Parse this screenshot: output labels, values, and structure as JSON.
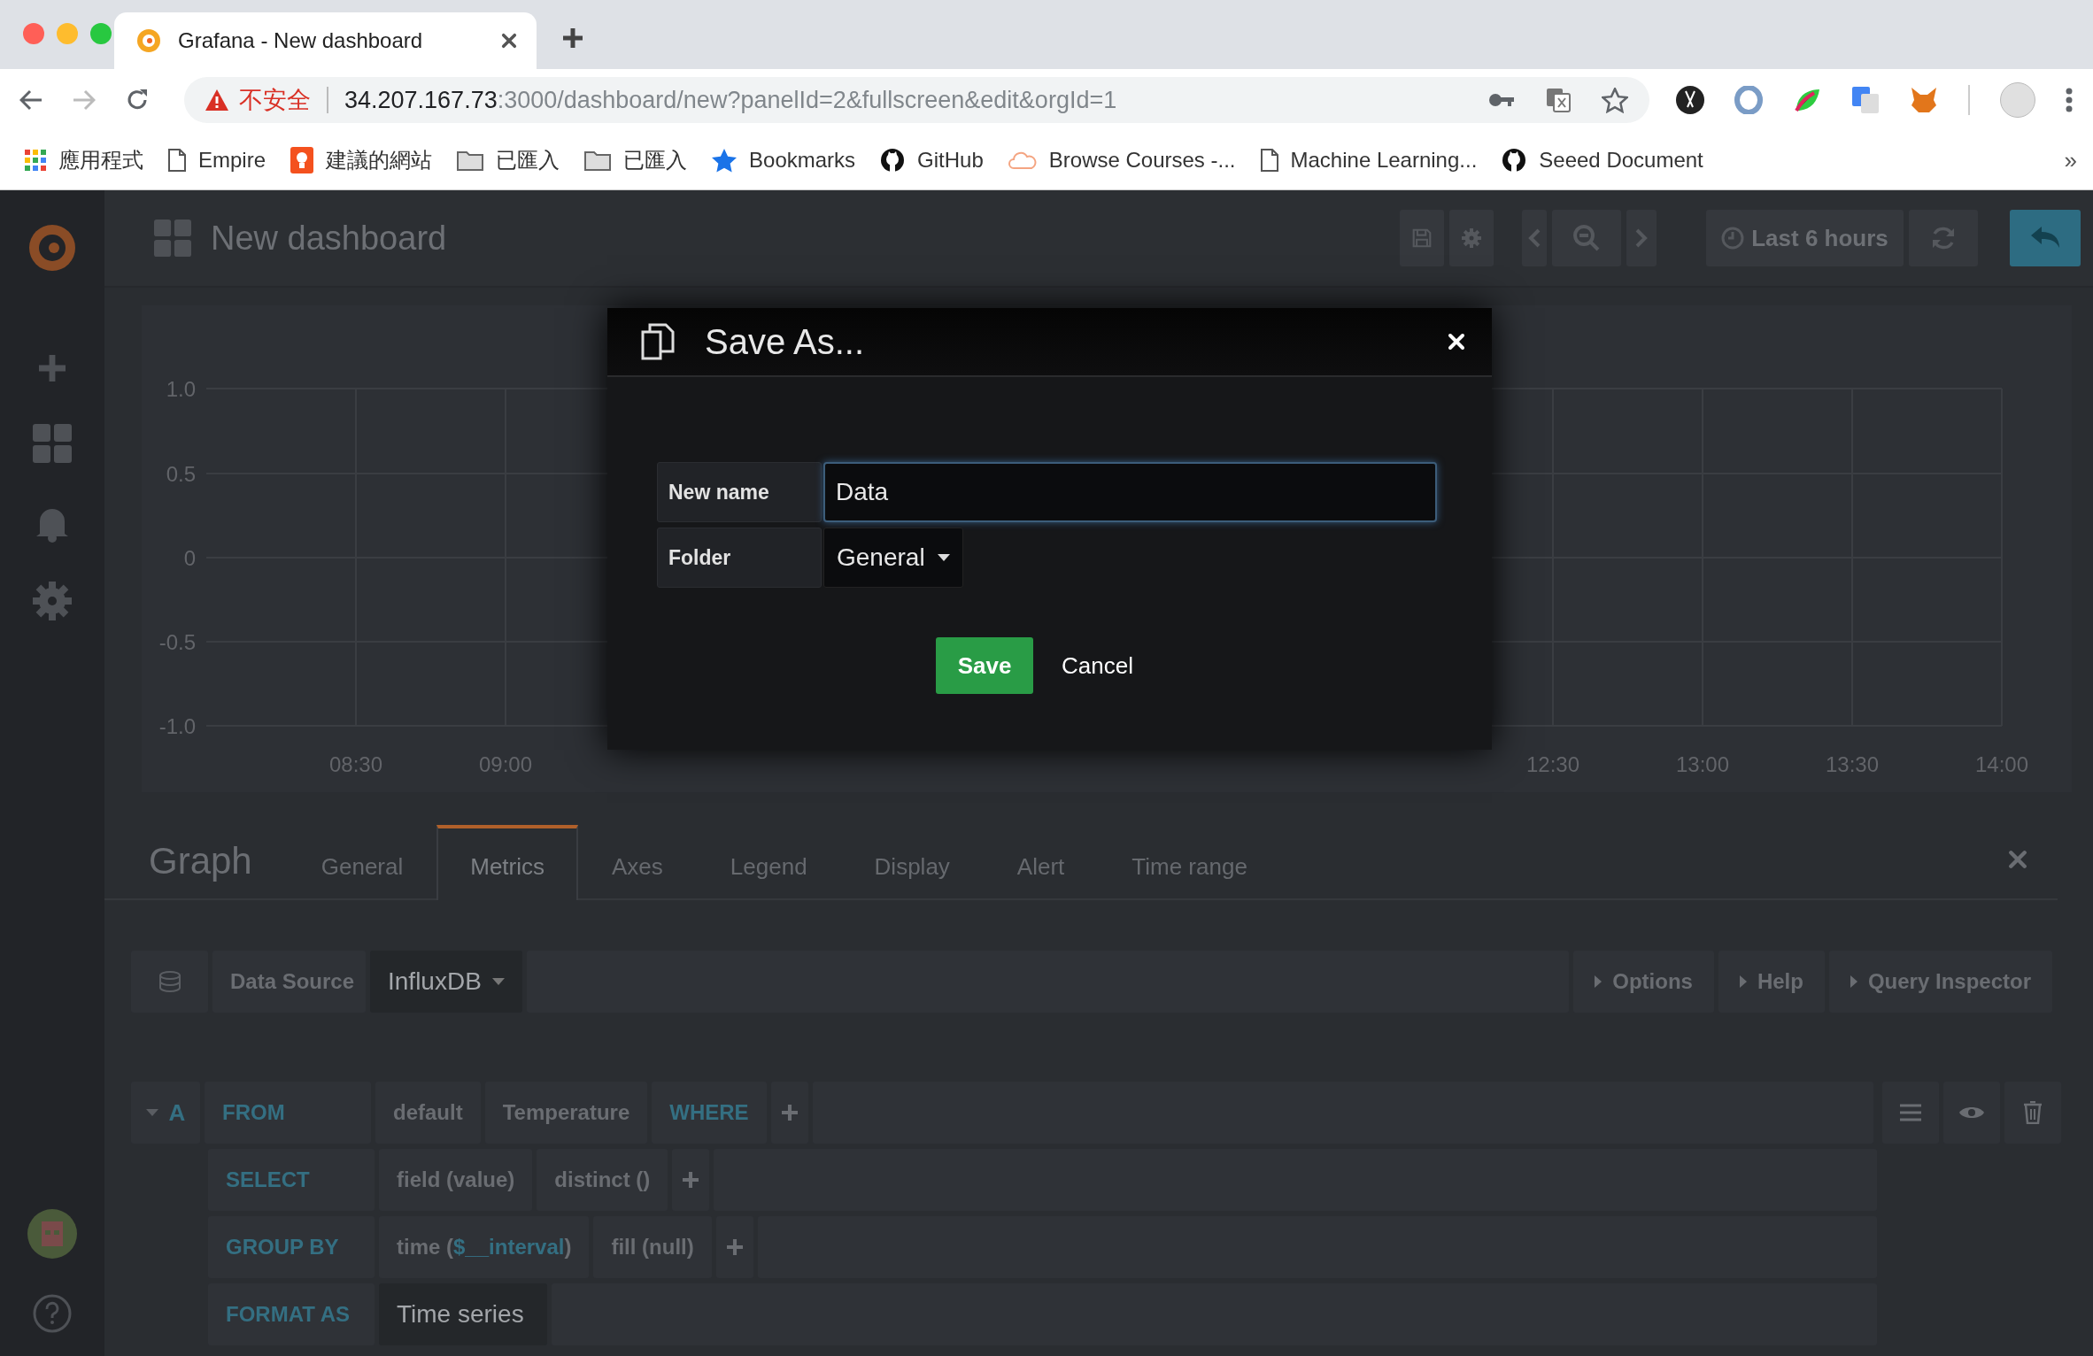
{
  "browser": {
    "tab": {
      "title": "Grafana - New dashboard"
    },
    "address_bar": {
      "security_label": "不安全",
      "host": "34.207.167.73",
      "path": ":3000/dashboard/new?panelId=2&fullscreen&edit&orgId=1"
    },
    "bookmarks": [
      {
        "label": "應用程式",
        "kind": "apps"
      },
      {
        "label": "Empire",
        "kind": "page"
      },
      {
        "label": "建議的網站",
        "kind": "bulb"
      },
      {
        "label": "已匯入",
        "kind": "folder"
      },
      {
        "label": "已匯入",
        "kind": "folder"
      },
      {
        "label": "Bookmarks",
        "kind": "star"
      },
      {
        "label": "GitHub",
        "kind": "github"
      },
      {
        "label": "Browse Courses -...",
        "kind": "cloud"
      },
      {
        "label": "Machine Learning...",
        "kind": "page"
      },
      {
        "label": "Seeed Document",
        "kind": "github"
      }
    ],
    "bookmarks_overflow": "»"
  },
  "dashboard": {
    "title": "New dashboard",
    "time_range": "Last 6 hours"
  },
  "graph": {
    "y_labels": [
      "1.0",
      "0.5",
      "0",
      "-0.5",
      "-1.0"
    ],
    "x_labels_left": [
      "08:30",
      "09:00"
    ],
    "x_labels_right": [
      "12:30",
      "13:00",
      "13:30",
      "14:00"
    ]
  },
  "editor": {
    "title": "Graph",
    "tabs": [
      {
        "label": "General",
        "selected": false
      },
      {
        "label": "Metrics",
        "selected": true
      },
      {
        "label": "Axes",
        "selected": false
      },
      {
        "label": "Legend",
        "selected": false
      },
      {
        "label": "Display",
        "selected": false
      },
      {
        "label": "Alert",
        "selected": false
      },
      {
        "label": "Time range",
        "selected": false
      }
    ],
    "data_source": {
      "label": "Data Source",
      "value": "InfluxDB",
      "toggles": [
        "Options",
        "Help",
        "Query Inspector"
      ]
    },
    "query": {
      "ref_id": "A",
      "rows": [
        {
          "keyword": "FROM",
          "parts": [
            {
              "kind": "segment",
              "text": "default"
            },
            {
              "kind": "segment",
              "text": "Temperature"
            },
            {
              "kind": "keyword",
              "text": "WHERE"
            },
            {
              "kind": "add"
            }
          ]
        },
        {
          "keyword": "SELECT",
          "parts": [
            {
              "kind": "segment",
              "text": "field (value)"
            },
            {
              "kind": "segment",
              "text": "distinct ()"
            },
            {
              "kind": "add"
            }
          ]
        },
        {
          "keyword": "GROUP BY",
          "parts": [
            {
              "kind": "variable",
              "prefix": "time (",
              "variable": "$__interval",
              "suffix": ")"
            },
            {
              "kind": "segment",
              "text": "fill (null)"
            },
            {
              "kind": "add"
            }
          ]
        },
        {
          "keyword": "FORMAT AS",
          "parts": [
            {
              "kind": "select",
              "text": "Time series"
            }
          ]
        }
      ]
    }
  },
  "modal": {
    "title": "Save As...",
    "fields": [
      {
        "kind": "input",
        "label": "New name",
        "value": "Data"
      },
      {
        "kind": "select",
        "label": "Folder",
        "value": "General"
      }
    ],
    "buttons": [
      {
        "kind": "primary",
        "label": "Save"
      },
      {
        "kind": "link",
        "label": "Cancel"
      }
    ]
  }
}
